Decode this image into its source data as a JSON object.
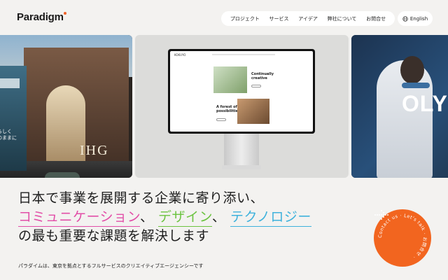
{
  "brand": {
    "logo": "Paradigm",
    "accent": "#f0632a"
  },
  "nav": {
    "items": [
      "プロジェクト",
      "サービス",
      "アイデア",
      "弊社について",
      "お問合せ"
    ],
    "language": "English"
  },
  "hero": {
    "panel1_text": "IHG",
    "panel1_side_text": "らしく\nのままに",
    "panel3_text": "OLY",
    "monitor": {
      "site_logo": "KOKUYO",
      "card1_title": "Continually creative",
      "card2_title": "A forest of possibilities"
    }
  },
  "headline": {
    "line1": "日本で事業を展開する企業に寄り添い、",
    "kw1": "コミュニケーション",
    "sep1": "、",
    "kw2": "デザイン",
    "sep2": "、",
    "kw3": "テクノロジー",
    "line3": "の最も重要な課題を解決します",
    "colors": {
      "kw1": "#e24fa8",
      "kw2": "#6cc340",
      "kw3": "#3fb2dc"
    }
  },
  "subtext": "パラダイムは、東京を拠点とするフルサービスのクリエイティブエージェンシーです",
  "contact": {
    "ring_text_en": "Contact us · Let's talk ·",
    "ring_text_jp": "お問合せ ·",
    "arrow_icon": "dotted-arrow-icon",
    "color": "#f2651f"
  }
}
